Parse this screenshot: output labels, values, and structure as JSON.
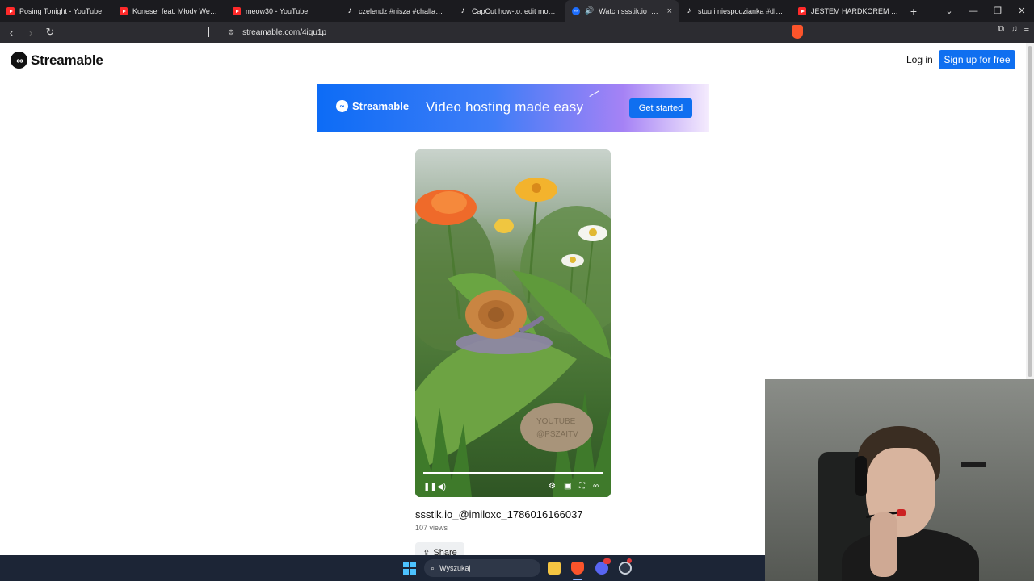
{
  "browser": {
    "tabs": [
      {
        "title": "Posing Tonight - YouTube",
        "icon": "youtube-icon",
        "active": false
      },
      {
        "title": "Koneser feat. Młody West - M",
        "icon": "youtube-icon",
        "active": false
      },
      {
        "title": "meow30 - YouTube",
        "icon": "youtube-icon",
        "active": false
      },
      {
        "title": "czelendz #nisza #challange | T",
        "icon": "tiktok-icon",
        "active": false
      },
      {
        "title": "CapCut how-to: edit mobile v",
        "icon": "tiktok-icon",
        "active": false
      },
      {
        "title": "Watch ssstik.io_@imilo",
        "icon": "streamable-icon",
        "active": true
      },
      {
        "title": "stuu i niespodzianka #dlacieb",
        "icon": "tiktok-icon",
        "active": false
      },
      {
        "title": "JESTEM HARDKOREM TWARZ",
        "icon": "youtube-icon",
        "active": false
      }
    ],
    "new_tab_label": "+",
    "url": "streamable.com/4iqu1p"
  },
  "header": {
    "logo_text": "Streamable",
    "login_label": "Log in",
    "signup_label": "Sign up for free"
  },
  "banner": {
    "brand": "Streamable",
    "tagline": "Video hosting made easy",
    "cta_label": "Get started",
    "accent": "#0f6ff0"
  },
  "video": {
    "watermark_line1": "YOUTUBE",
    "watermark_line2": "@PSZAITV",
    "progress_percent": 100,
    "title": "ssstik.io_@imiloxc_1786016166037",
    "views": "107 views",
    "share_label": "Share"
  },
  "taskbar": {
    "search_placeholder": "Wyszukaj"
  }
}
